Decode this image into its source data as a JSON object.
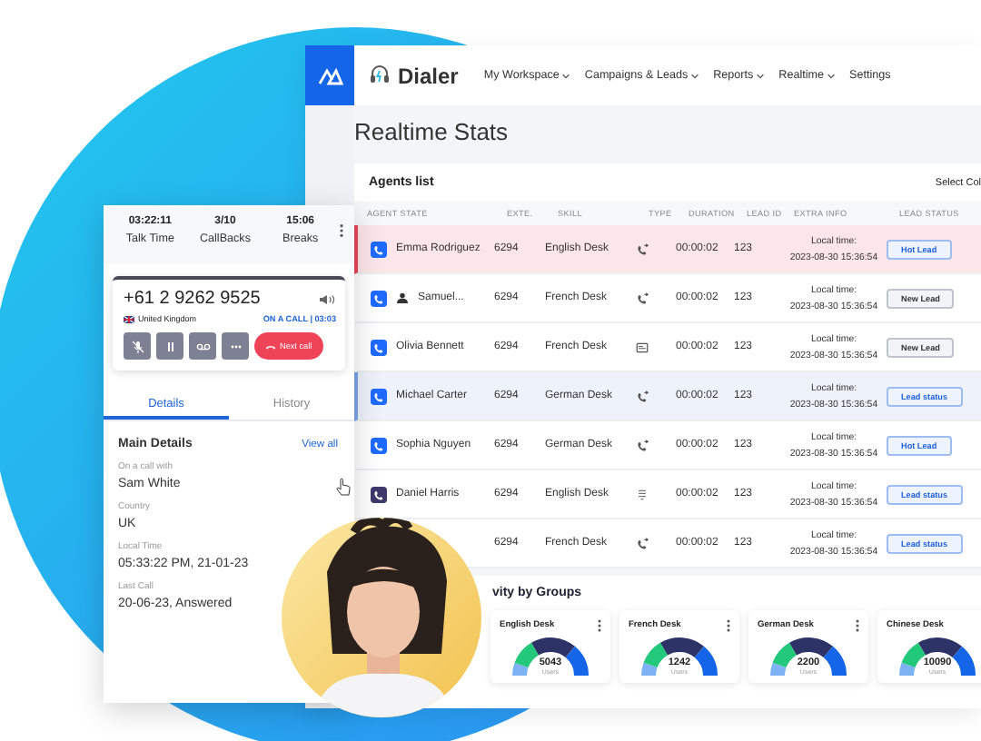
{
  "app": {
    "logo": "Dialer",
    "nav": [
      {
        "label": "My Workspace",
        "dropdown": true
      },
      {
        "label": "Campaigns & Leads",
        "dropdown": true
      },
      {
        "label": "Reports",
        "dropdown": true
      },
      {
        "label": "Realtime",
        "dropdown": true
      },
      {
        "label": "Settings",
        "dropdown": false
      }
    ]
  },
  "page": {
    "title": "Realtime Stats"
  },
  "agents": {
    "title": "Agents list",
    "select_columns": "Select Col",
    "columns": [
      "AGENT STATE",
      "EXTE.",
      "SKILL",
      "TYPE",
      "DURATION",
      "LEAD ID",
      "EXTRA INFO",
      "LEAD STATUS"
    ],
    "rows": [
      {
        "name": "Emma Rodriguez",
        "conference": false,
        "alert": true,
        "selected": false,
        "color": "#1f6bff",
        "ext": "6294",
        "skill": "English Desk",
        "type": {
          "kind": "call"
        },
        "duration": "00:00:02",
        "lead_id": "123",
        "info_label": "Local time:",
        "info_value": "2023-08-30 15:36:54",
        "lead_status": {
          "label": "Hot Lead",
          "kind": "accent"
        }
      },
      {
        "name": "Samuel...",
        "conference": true,
        "alert": false,
        "selected": false,
        "color": "#1f6bff",
        "ext": "6294",
        "skill": "French Desk",
        "type": {
          "kind": "call"
        },
        "duration": "00:00:02",
        "lead_id": "123",
        "info_label": "Local time:",
        "info_value": "2023-08-30 15:36:54",
        "lead_status": {
          "label": "New Lead",
          "kind": "neutral"
        }
      },
      {
        "name": "Olivia Bennett",
        "conference": false,
        "alert": false,
        "selected": false,
        "color": "#1f6bff",
        "ext": "6294",
        "skill": "French Desk",
        "type": {
          "kind": "card"
        },
        "duration": "00:00:02",
        "lead_id": "123",
        "info_label": "Local time:",
        "info_value": "2023-08-30 15:36:54",
        "lead_status": {
          "label": "New Lead",
          "kind": "neutral"
        }
      },
      {
        "name": "Michael Carter",
        "conference": false,
        "alert": false,
        "selected": true,
        "color": "#1f6bff",
        "ext": "6294",
        "skill": "German Desk",
        "type": {
          "kind": "call"
        },
        "duration": "00:00:02",
        "lead_id": "123",
        "info_label": "Local time:",
        "info_value": "2023-08-30 15:36:54",
        "lead_status": {
          "label": "Lead status",
          "kind": "accent"
        }
      },
      {
        "name": "Sophia Nguyen",
        "conference": false,
        "alert": false,
        "selected": false,
        "color": "#1f6bff",
        "ext": "6294",
        "skill": "German Desk",
        "type": {
          "kind": "call"
        },
        "duration": "00:00:02",
        "lead_id": "123",
        "info_label": "Local time:",
        "info_value": "2023-08-30 15:36:54",
        "lead_status": {
          "label": "Hot Lead",
          "kind": "accent"
        }
      },
      {
        "name": "Daniel Harris",
        "conference": false,
        "alert": false,
        "selected": false,
        "color": "#3d3a6b",
        "ext": "6294",
        "skill": "English Desk",
        "type": {
          "kind": "list"
        },
        "duration": "00:00:02",
        "lead_id": "123",
        "info_label": "Local time:",
        "info_value": "2023-08-30 15:36:54",
        "lead_status": {
          "label": "Lead status",
          "kind": "accent"
        }
      },
      {
        "alert": false,
        "selected": false,
        "ext": "6294",
        "skill": "French Desk",
        "type": {
          "kind": "call"
        },
        "duration": "00:00:02",
        "lead_id": "123",
        "info_label": "Local time:",
        "info_value": "2023-08-30 15:36:54",
        "lead_status": {
          "label": "Lead status",
          "kind": "accent"
        }
      }
    ]
  },
  "activity": {
    "title": "vity by Groups",
    "groups": [
      {
        "name": "English Desk",
        "count": "5043",
        "unit": "Users"
      },
      {
        "name": "French Desk",
        "count": "1242",
        "unit": "Users"
      },
      {
        "name": "German Desk",
        "count": "2200",
        "unit": "Users"
      },
      {
        "name": "Chinese Desk",
        "count": "10090",
        "unit": "Users"
      }
    ]
  },
  "agent_panel": {
    "stats": [
      {
        "value": "03:22:11",
        "label": "Talk Time"
      },
      {
        "value": "3/10",
        "label": "CallBacks"
      },
      {
        "value": "15:06",
        "label": "Breaks"
      }
    ],
    "call": {
      "number": "+61 2 9262 9525",
      "country": "United Kingdom",
      "status": "ON A CALL | 03:03",
      "next_button": "Next call"
    },
    "tabs": [
      {
        "label": "Details",
        "selected": true
      },
      {
        "label": "History",
        "selected": false
      }
    ],
    "details": {
      "title": "Main Details",
      "link": "View all",
      "fields": [
        {
          "label": "On a call with",
          "value": "Sam White"
        },
        {
          "label": "Country",
          "value": "UK"
        },
        {
          "label": "Local Time",
          "value": "05:33:22 PM, 21-01-23"
        },
        {
          "label": "Last Call",
          "value": "20-06-23, Answered"
        }
      ]
    }
  }
}
